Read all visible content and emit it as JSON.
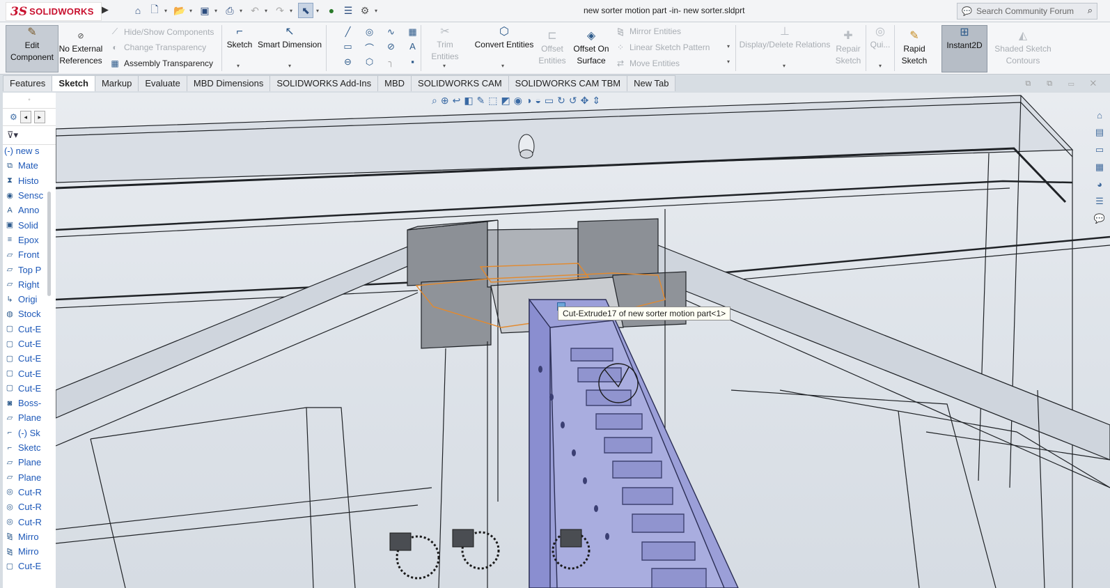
{
  "app": {
    "logo_prefix": "3S",
    "logo_text": "SOLIDWORKS",
    "document_title": "new sorter motion part -in- new sorter.sldprt",
    "search_placeholder": "Search Community Forum"
  },
  "quick_access": [
    {
      "name": "home-icon",
      "glyph": "⌂"
    },
    {
      "name": "new-document-icon",
      "glyph": "🗋"
    },
    {
      "name": "open-folder-icon",
      "glyph": "📂"
    },
    {
      "name": "save-icon",
      "glyph": "💾"
    },
    {
      "name": "print-icon",
      "glyph": "🖶"
    },
    {
      "name": "undo-icon",
      "glyph": "↶"
    },
    {
      "name": "redo-icon",
      "glyph": "↷"
    },
    {
      "name": "select-pointer-icon",
      "glyph": "⬉"
    },
    {
      "name": "rebuild-icon",
      "glyph": "🚦"
    },
    {
      "name": "file-properties-icon",
      "glyph": "☰"
    },
    {
      "name": "options-gear-icon",
      "glyph": "⚙"
    }
  ],
  "ribbon": {
    "edit_component": [
      "Edit",
      "Component"
    ],
    "no_external": [
      "No External",
      "References"
    ],
    "hide_show": "Hide/Show Components",
    "change_transparency": "Change Transparency",
    "assembly_transparency": "Assembly Transparency",
    "sketch": "Sketch",
    "smart_dimension": "Smart Dimension",
    "trim_entities": "Trim Entities",
    "convert_entities": "Convert Entities",
    "offset_entities": [
      "Offset",
      "Entities"
    ],
    "offset_on_surface": [
      "Offset On",
      "Surface"
    ],
    "mirror_entities": "Mirror Entities",
    "linear_sketch_pattern": "Linear Sketch Pattern",
    "move_entities": "Move Entities",
    "display_delete_relations": "Display/Delete Relations",
    "repair_sketch": [
      "Repair",
      "Sketch"
    ],
    "quick_snaps": "Qui...",
    "rapid_sketch": [
      "Rapid",
      "Sketch"
    ],
    "instant2d": "Instant2D",
    "shaded_sketch_contours": [
      "Shaded Sketch",
      "Contours"
    ]
  },
  "tabs": [
    "Features",
    "Sketch",
    "Markup",
    "Evaluate",
    "MBD Dimensions",
    "SOLIDWORKS Add-Ins",
    "MBD",
    "SOLIDWORKS CAM",
    "SOLIDWORKS CAM TBM",
    "New Tab"
  ],
  "feature_tree": [
    {
      "label": "(-) new s",
      "icon": "part-icon"
    },
    {
      "label": "Mate",
      "icon": "mate-icon"
    },
    {
      "label": "Histo",
      "icon": "history-icon"
    },
    {
      "label": "Sensc",
      "icon": "sensor-icon"
    },
    {
      "label": "Anno",
      "icon": "annotation-icon"
    },
    {
      "label": "Solid",
      "icon": "solid-bodies-icon"
    },
    {
      "label": "Epox",
      "icon": "material-icon"
    },
    {
      "label": "Front",
      "icon": "plane-icon"
    },
    {
      "label": "Top P",
      "icon": "plane-icon"
    },
    {
      "label": "Right",
      "icon": "plane-icon"
    },
    {
      "label": "Origi",
      "icon": "origin-icon"
    },
    {
      "label": "Stock",
      "icon": "stock-icon"
    },
    {
      "label": "Cut-E",
      "icon": "cut-extrude-icon"
    },
    {
      "label": "Cut-E",
      "icon": "cut-extrude-icon"
    },
    {
      "label": "Cut-E",
      "icon": "cut-extrude-icon"
    },
    {
      "label": "Cut-E",
      "icon": "cut-extrude-icon"
    },
    {
      "label": "Cut-E",
      "icon": "cut-extrude-icon"
    },
    {
      "label": "Boss-",
      "icon": "boss-extrude-icon"
    },
    {
      "label": "Plane",
      "icon": "plane-icon"
    },
    {
      "label": "(-) Sk",
      "icon": "sketch-icon"
    },
    {
      "label": "Sketc",
      "icon": "sketch-icon"
    },
    {
      "label": "Plane",
      "icon": "plane-icon"
    },
    {
      "label": "Plane",
      "icon": "plane-icon"
    },
    {
      "label": "Cut-R",
      "icon": "cut-revolve-icon"
    },
    {
      "label": "Cut-R",
      "icon": "cut-revolve-icon"
    },
    {
      "label": "Cut-R",
      "icon": "cut-revolve-icon"
    },
    {
      "label": "Mirro",
      "icon": "mirror-icon"
    },
    {
      "label": "Mirro",
      "icon": "mirror-icon"
    },
    {
      "label": "Cut-E",
      "icon": "cut-extrude-icon"
    }
  ],
  "tooltip": "Cut-Extrude17 of new sorter motion part<1>",
  "colors": {
    "accent": "#1d58b8",
    "brand": "#c8102e",
    "highlight": "#e38a2e",
    "conveyor": "#9b9fd8"
  }
}
